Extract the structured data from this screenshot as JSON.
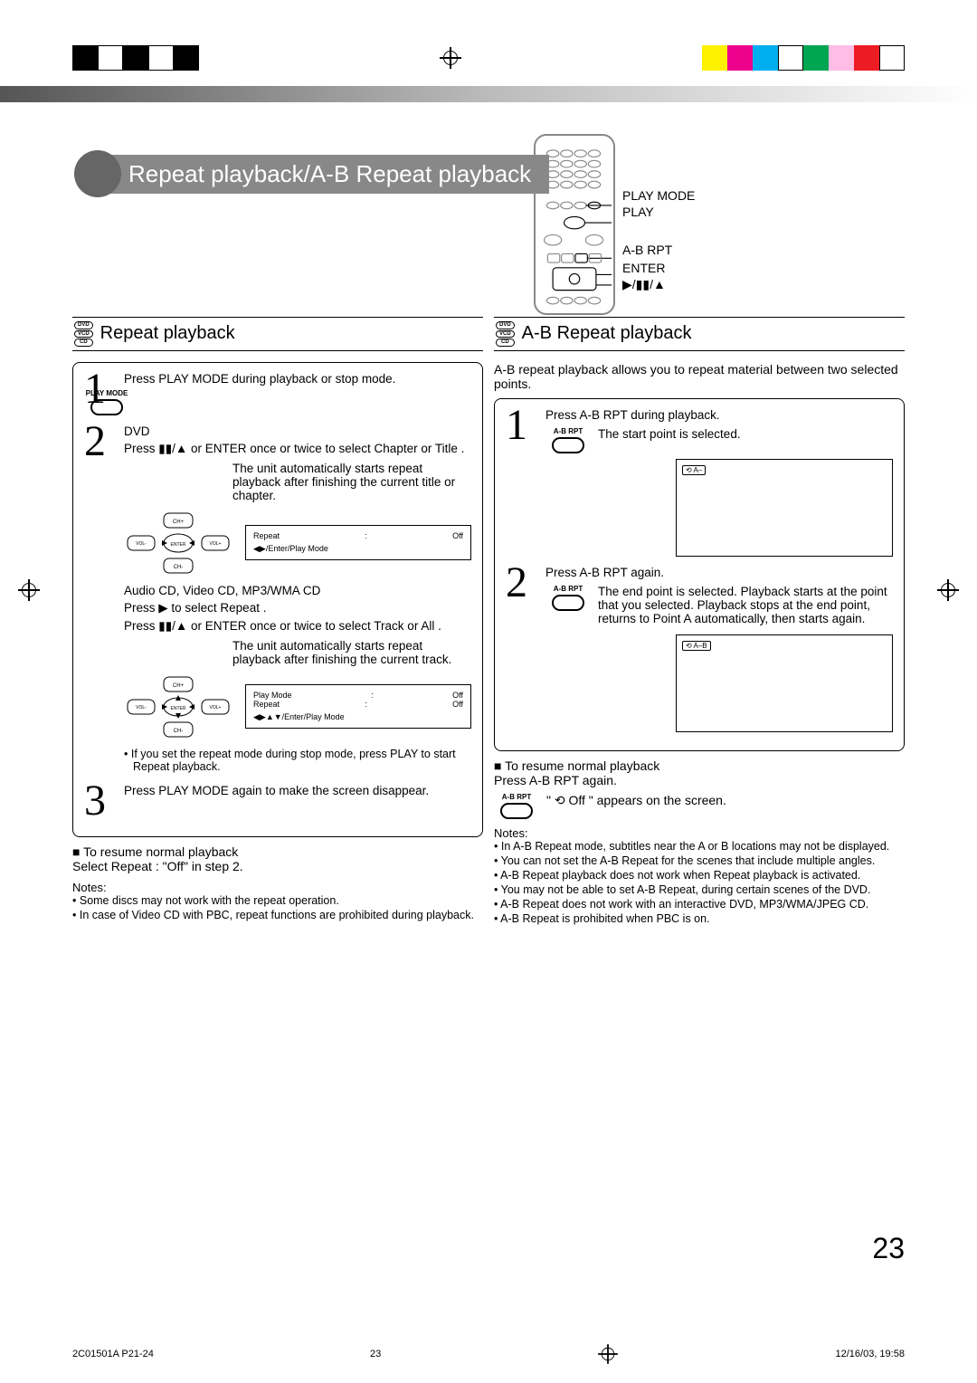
{
  "page_title": "Repeat playback/A-B Repeat playback",
  "remote_labels": {
    "l1": "PLAY MODE",
    "l2": "PLAY",
    "l3": "A-B RPT",
    "l4": "ENTER",
    "l5": "▶/▮▮/▲"
  },
  "left": {
    "heading": "Repeat playback",
    "discs": [
      "DVD",
      "VCD",
      "CD"
    ],
    "step1": {
      "text": "Press PLAY MODE during playback or stop mode.",
      "btn": "PLAY MODE"
    },
    "step2": {
      "line1": "DVD",
      "line2": "Press ▮▮/▲ or ENTER once or twice to select Chapter or Title .",
      "result": "The unit automatically starts repeat playback after finishing the current title or chapter.",
      "osd1_k": "Repeat",
      "osd1_v": "Off",
      "osd1_f": "◀▶/Enter/Play Mode",
      "line3": "Audio CD, Video CD, MP3/WMA CD",
      "line4": "Press ▶ to select Repeat .",
      "line5": "Press ▮▮/▲ or ENTER once or twice to select Track or All .",
      "result2": "The unit automatically starts repeat playback after finishing the current track.",
      "osd2_k1": "Play Mode",
      "osd2_v1": "Off",
      "osd2_k2": "Repeat",
      "osd2_v2": "Off",
      "osd2_f": "◀▶▲▼/Enter/Play Mode",
      "bullet": "If you set the repeat mode during stop mode, press PLAY to start Repeat playback."
    },
    "step3": "Press PLAY MODE again to make the screen disappear.",
    "resume_h": "To resume normal playback",
    "resume_t": "Select Repeat : \"Off\" in step 2.",
    "notes_h": "Notes:",
    "notes": [
      "Some discs may not work with the repeat operation.",
      "In case of Video CD with PBC, repeat functions are prohibited during playback."
    ]
  },
  "right": {
    "heading": "A-B Repeat playback",
    "discs": [
      "DVD",
      "VCD",
      "CD"
    ],
    "intro": "A-B repeat playback allows you to repeat material between two selected points.",
    "step1": {
      "text": "Press A-B RPT during playback.",
      "btn": "A-B RPT",
      "result": "The start point is selected.",
      "chip": "⟲ A–"
    },
    "step2": {
      "text": "Press A-B RPT again.",
      "btn": "A-B RPT",
      "result": "The end point is selected. Playback starts at the point that you selected. Playback stops at the end point, returns to Point A automatically, then starts again.",
      "chip": "⟲ A–B"
    },
    "resume_h": "To resume normal playback",
    "resume_t": "Press A-B RPT again.",
    "resume_btn": "A-B RPT",
    "resume_screen": "\" ⟲ Off \" appears on the screen.",
    "notes_h": "Notes:",
    "notes": [
      "In A-B Repeat mode, subtitles near the A or B locations may not be displayed.",
      "You can not set the A-B Repeat for the scenes that include multiple angles.",
      "A-B Repeat playback does not work when Repeat playback is activated.",
      "You may not be able to set A-B Repeat, during certain scenes of the DVD.",
      "A-B Repeat does not work with an interactive DVD, MP3/WMA/JPEG CD.",
      "A-B Repeat is prohibited when PBC is on."
    ]
  },
  "page_number": "23",
  "footer": {
    "left": "2C01501A P21-24",
    "mid": "23",
    "right": "12/16/03, 19:58"
  },
  "dpad": {
    "up": "CH+",
    "down": "CH-",
    "left": "VOL-",
    "right": "VOL+",
    "center": "ENTER"
  }
}
